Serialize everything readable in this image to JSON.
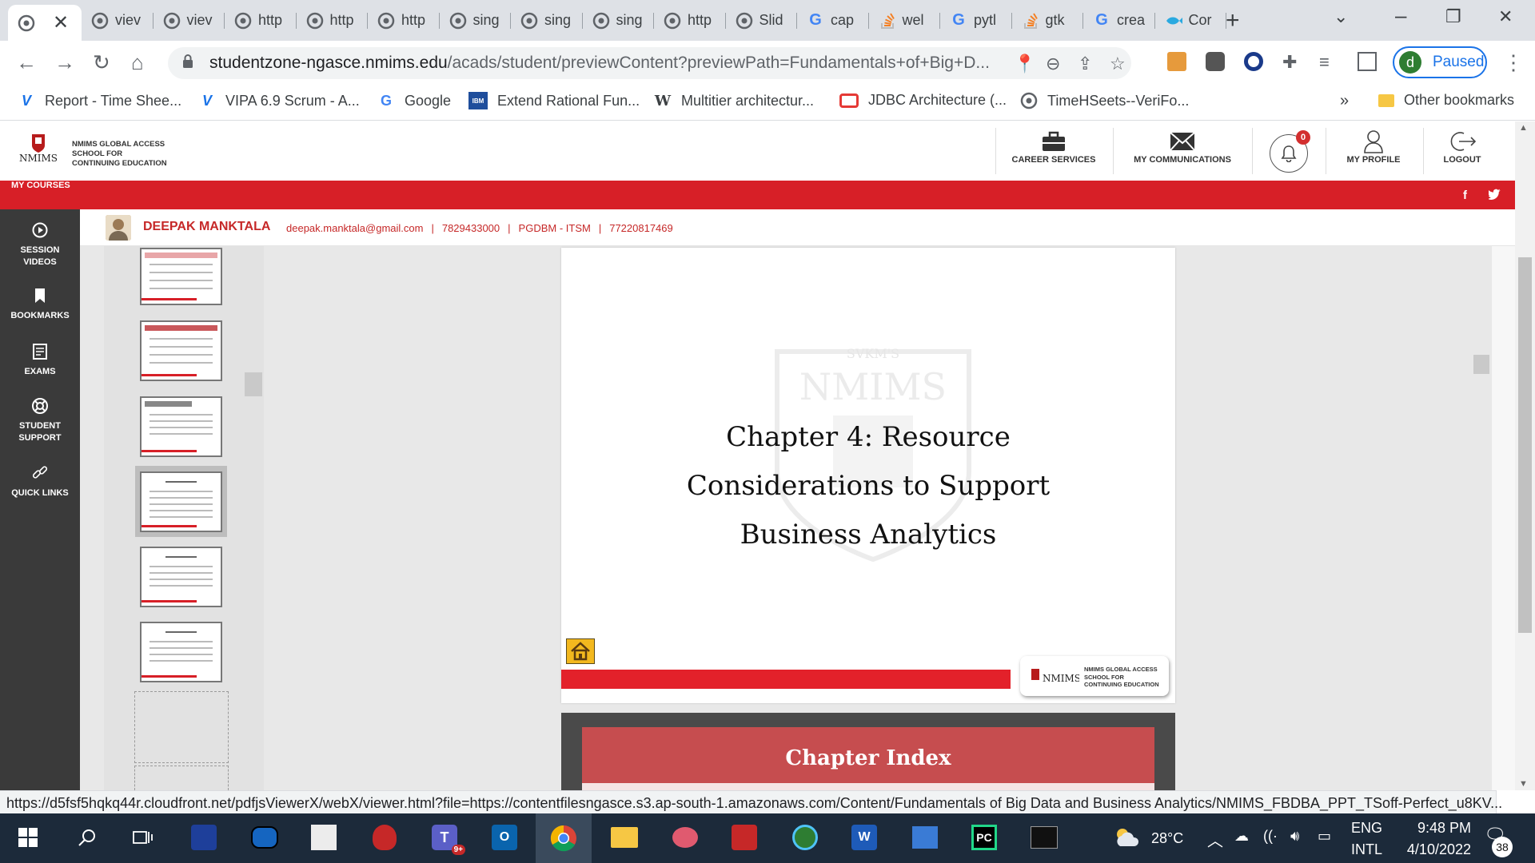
{
  "browser": {
    "tabs": [
      {
        "label": "",
        "icon": "globe-icon",
        "active": true
      },
      {
        "label": "viev",
        "icon": "globe-icon"
      },
      {
        "label": "viev",
        "icon": "globe-icon"
      },
      {
        "label": "http",
        "icon": "globe-icon"
      },
      {
        "label": "http",
        "icon": "globe-icon"
      },
      {
        "label": "http",
        "icon": "globe-icon"
      },
      {
        "label": "sing",
        "icon": "globe-icon"
      },
      {
        "label": "sing",
        "icon": "globe-icon"
      },
      {
        "label": "sing",
        "icon": "globe-icon"
      },
      {
        "label": "http",
        "icon": "globe-icon"
      },
      {
        "label": "Slid",
        "icon": "globe-icon"
      },
      {
        "label": "cap",
        "icon": "google-icon"
      },
      {
        "label": "wel",
        "icon": "stackoverflow-icon"
      },
      {
        "label": "pytl",
        "icon": "google-icon"
      },
      {
        "label": "gtk",
        "icon": "stackoverflow-icon"
      },
      {
        "label": "crea",
        "icon": "google-icon"
      },
      {
        "label": "Cor",
        "icon": "fish-icon"
      }
    ],
    "url_host": "studentzone-ngasce.nmims.edu",
    "url_path": "/acads/student/previewContent?previewPath=Fundamentals+of+Big+D...",
    "profile_initial": "d",
    "profile_label": "Paused",
    "bookmarks": [
      {
        "label": "Report - Time Shee...",
        "icon": "v-logo-icon"
      },
      {
        "label": "VIPA 6.9 Scrum - A...",
        "icon": "v-logo-icon"
      },
      {
        "label": "Google",
        "icon": "google-icon"
      },
      {
        "label": "Extend Rational Fun...",
        "icon": "ibm-icon"
      },
      {
        "label": "Multitier architectur...",
        "icon": "wikipedia-icon"
      },
      {
        "label": "JDBC Architecture (...",
        "icon": "oracle-icon"
      },
      {
        "label": "TimeHSeets--VeriFo...",
        "icon": "globe-icon"
      }
    ],
    "bookmarks_overflow": "»",
    "other_bookmarks": "Other bookmarks"
  },
  "site": {
    "logo_name": "NMIMS",
    "logo_text_lines": [
      "NMIMS GLOBAL ACCESS",
      "SCHOOL FOR",
      "CONTINUING EDUCATION"
    ],
    "header_items": {
      "career": "CAREER SERVICES",
      "communications": "MY COMMUNICATIONS",
      "notification_count": "0",
      "profile": "MY PROFILE",
      "logout": "LOGOUT"
    },
    "my_courses": "MY COURSES",
    "social": {
      "facebook": "f",
      "twitter": "🐦"
    },
    "left_nav": [
      {
        "label_1": "SESSION",
        "label_2": "VIDEOS"
      },
      {
        "label_1": "BOOKMARKS",
        "label_2": ""
      },
      {
        "label_1": "EXAMS",
        "label_2": ""
      },
      {
        "label_1": "STUDENT",
        "label_2": "SUPPORT"
      },
      {
        "label_1": "QUICK LINKS",
        "label_2": ""
      }
    ],
    "student": {
      "name": "DEEPAK MANKTALA",
      "email": "deepak.manktala@gmail.com",
      "phone": "7829433000",
      "program": "PGDBM - ITSM",
      "id": "77220817469"
    }
  },
  "viewer": {
    "slide_title_lines": [
      "Chapter 4: Resource",
      "Considerations to Support",
      "Business Analytics"
    ],
    "slide_watermark_top": "SVKM'S",
    "slide_watermark_main": "NMIMS",
    "slide_logo_name": "NMIMS",
    "slide_logo_lines": [
      "NMIMS GLOBAL ACCESS",
      "SCHOOL FOR",
      "CONTINUING EDUCATION"
    ],
    "next_slide_title": "Chapter Index"
  },
  "status_url": "https://d5fsf5hqkq44r.cloudfront.net/pdfjsViewerX/webX/viewer.html?file=https://contentfilesngasce.s3.ap-south-1.amazonaws.com/Content/Fundamentals of Big Data and Business Analytics/NMIMS_FBDBA_PPT_TSoff-Perfect_u8KV...",
  "taskbar": {
    "temperature": "28°C",
    "lang_1": "ENG",
    "lang_2": "INTL",
    "time": "9:48 PM",
    "date": "4/10/2022",
    "notification_count": "38",
    "teams_badge": "9+"
  },
  "colors": {
    "brand_red": "#d71f27",
    "nav_dark": "#3a3a3a",
    "slide_index_red": "#c64d4f"
  }
}
